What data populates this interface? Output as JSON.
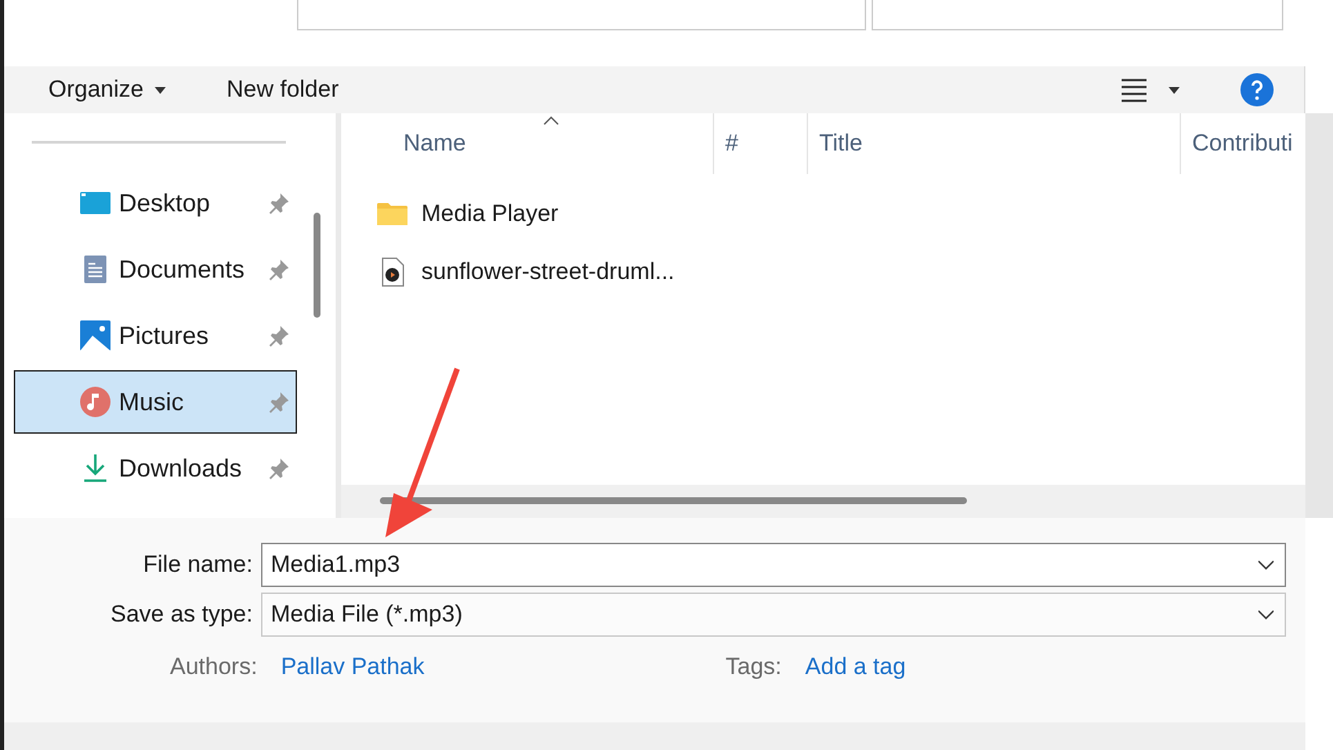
{
  "toolbar": {
    "organize": "Organize",
    "new_folder": "New folder"
  },
  "nav": [
    {
      "label": "Desktop",
      "kind": "desktop",
      "selected": false
    },
    {
      "label": "Documents",
      "kind": "documents",
      "selected": false
    },
    {
      "label": "Pictures",
      "kind": "pictures",
      "selected": false
    },
    {
      "label": "Music",
      "kind": "music",
      "selected": true
    },
    {
      "label": "Downloads",
      "kind": "downloads",
      "selected": false
    }
  ],
  "columns": [
    "Name",
    "#",
    "Title",
    "Contributi"
  ],
  "files": [
    {
      "name": "Media Player",
      "kind": "folder"
    },
    {
      "name": "sunflower-street-druml...",
      "kind": "audio"
    }
  ],
  "form": {
    "file_name_label": "File name:",
    "file_name": "Media1.mp3",
    "type_label": "Save as type:",
    "type": "Media File (*.mp3)",
    "authors_label": "Authors:",
    "authors": "Pallav Pathak",
    "tags_label": "Tags:",
    "tags": "Add a tag"
  }
}
